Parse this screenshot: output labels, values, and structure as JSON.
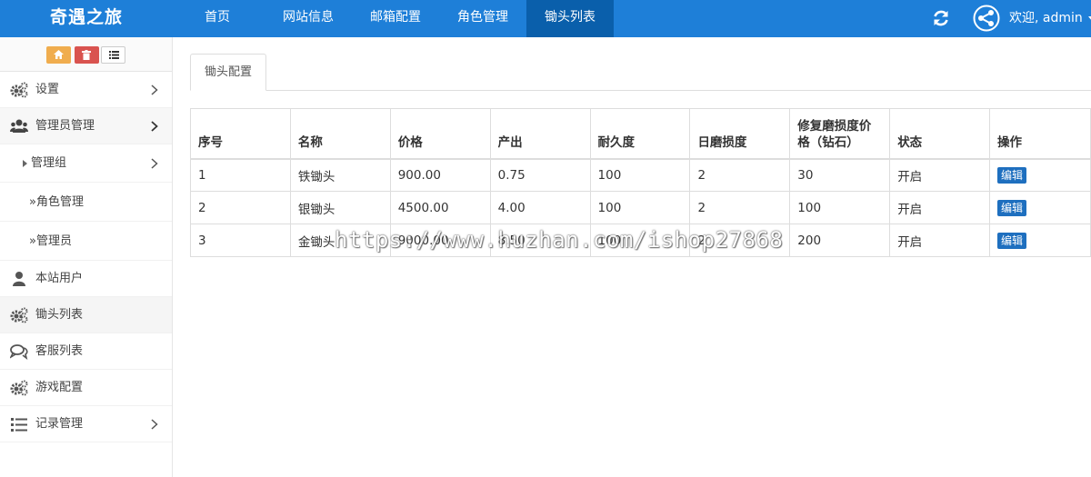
{
  "navbar": {
    "brand": "奇遇之旅",
    "items": [
      {
        "label": "首页"
      },
      {
        "label": "网站信息"
      },
      {
        "label": "邮箱配置"
      },
      {
        "label": "角色管理"
      },
      {
        "label": "锄头列表"
      }
    ],
    "active_index": 4,
    "welcome": "欢迎, admin",
    "icons": {
      "refresh": "refresh-icon",
      "user": "share-icon"
    }
  },
  "sidebar": {
    "items": [
      {
        "label": "设置",
        "icon": "cogs-icon"
      },
      {
        "label": "管理员管理",
        "icon": "users-icon"
      },
      {
        "label": "管理组"
      },
      {
        "label": "»角色管理"
      },
      {
        "label": "»管理员"
      },
      {
        "label": "本站用户",
        "icon": "user-icon"
      },
      {
        "label": "锄头列表",
        "icon": "cogs-icon"
      },
      {
        "label": "客服列表",
        "icon": "comments-icon"
      },
      {
        "label": "游戏配置",
        "icon": "cogs-icon"
      },
      {
        "label": "记录管理",
        "icon": "list-icon"
      }
    ]
  },
  "tab": {
    "label": "锄头配置"
  },
  "table": {
    "headers": [
      "序号",
      "名称",
      "价格",
      "产出",
      "耐久度",
      "日磨损度",
      "修复磨损度价格（钻石）",
      "状态",
      "操作"
    ],
    "rows": [
      [
        "1",
        "铁锄头",
        "900.00",
        "0.75",
        "100",
        "2",
        "30",
        "开启",
        "编辑"
      ],
      [
        "2",
        "银锄头",
        "4500.00",
        "4.00",
        "100",
        "2",
        "100",
        "开启",
        "编辑"
      ],
      [
        "3",
        "金锄头",
        "9000.00",
        "8.50",
        "100",
        "2",
        "200",
        "开启",
        "编辑"
      ]
    ]
  },
  "watermark": "https://www.huzhan.com/ishop27868",
  "colors": {
    "navbar": "#1e7fd8",
    "navbar_active": "#0a5fab",
    "edit_button": "#1e6fbf"
  }
}
